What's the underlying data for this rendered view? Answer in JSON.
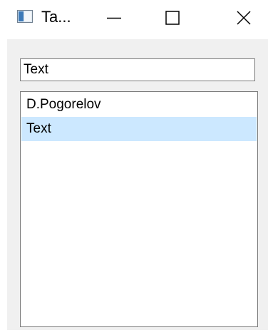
{
  "window": {
    "title": "Ta...",
    "icon": "window-app-icon",
    "controls": {
      "minimize_icon": "minimize-icon",
      "maximize_icon": "maximize-icon",
      "close_icon": "close-icon"
    }
  },
  "form": {
    "text_input": {
      "value": "Text"
    },
    "list": {
      "items": [
        {
          "label": "D.Pogorelov",
          "selected": false
        },
        {
          "label": "Text",
          "selected": true
        }
      ],
      "selection_color": "#cce8ff"
    }
  }
}
